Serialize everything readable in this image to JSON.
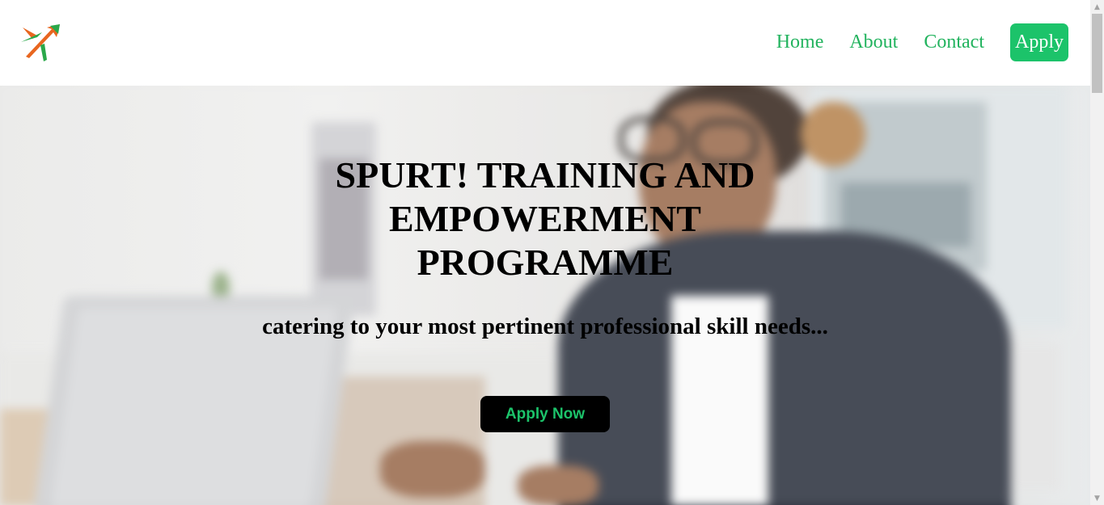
{
  "nav": {
    "logo_icon": "paper-plane-arrows-logo",
    "links": [
      {
        "label": "Home"
      },
      {
        "label": "About"
      },
      {
        "label": "Contact"
      }
    ],
    "apply_label": "Apply"
  },
  "hero": {
    "title": "SPURT! TRAINING AND EMPOWERMENT PROGRAMME",
    "subtitle": "catering to your most pertinent professional skill needs...",
    "cta_label": "Apply Now",
    "background_image": "woman-with-glasses-at-laptop-photo"
  },
  "colors": {
    "accent_green": "#1cc36a",
    "link_green": "#22b35e",
    "logo_orange": "#e8661f",
    "logo_green": "#2aa84a"
  },
  "scrollbar": {
    "up_icon": "scroll-up-arrow-icon",
    "down_icon": "scroll-down-arrow-icon"
  }
}
